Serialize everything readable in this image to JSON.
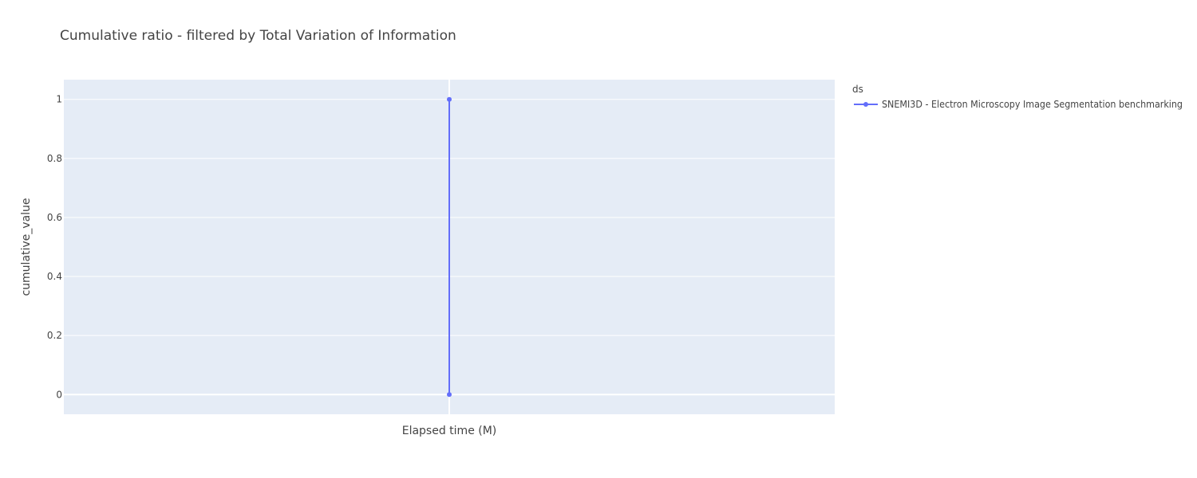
{
  "chart_data": {
    "type": "line",
    "title": "Cumulative ratio - filtered by Total Variation of Information",
    "xlabel": "Elapsed time (M)",
    "ylabel": "cumulative_value",
    "ylim": [
      -0.0667,
      1.0667
    ],
    "yticks": [
      0,
      0.2,
      0.4,
      0.6,
      0.8,
      1
    ],
    "ytick_labels": [
      "0",
      "0.2",
      "0.4",
      "0.6",
      "0.8",
      "1"
    ],
    "grid": true,
    "legend": {
      "title": "ds",
      "placement": "right"
    },
    "series": [
      {
        "name": "SNEMI3D - Electron Microscopy Image Segmentation benchmarking",
        "color": "#636efa",
        "points": [
          {
            "x": 0,
            "y": 0
          },
          {
            "x": 0,
            "y": 1
          }
        ]
      }
    ],
    "plot_bg": "#e5ecf6",
    "grid_color": "#ffffff",
    "text_color": "#444444"
  }
}
